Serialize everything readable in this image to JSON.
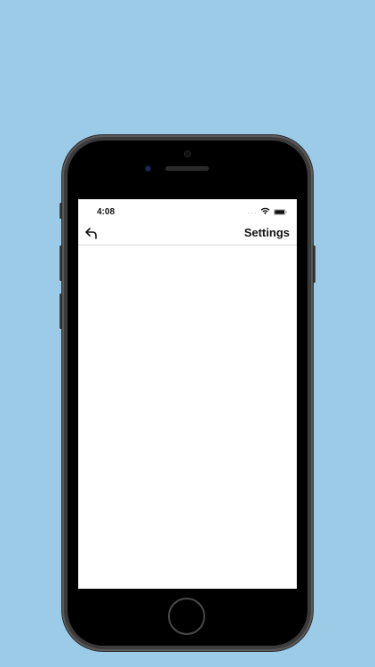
{
  "status_bar": {
    "time": "4:08",
    "signal_dots": "....",
    "wifi_icon": "wifi-icon",
    "battery_icon": "battery-icon"
  },
  "nav": {
    "back_icon": "back-arrow-icon",
    "title": "Settings"
  },
  "colors": {
    "background": "#9ccbe8",
    "phone_body": "#3b3b3b",
    "screen": "#ffffff"
  }
}
